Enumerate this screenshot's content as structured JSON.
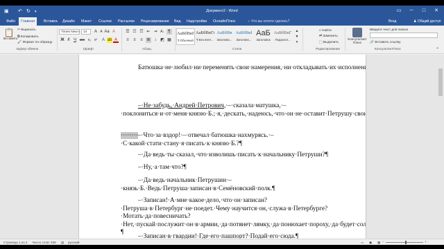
{
  "window": {
    "title": "Документ2 - Word",
    "qa_save_icon": "save-icon",
    "qa_undo_icon": "undo-icon",
    "qa_redo_icon": "redo-icon",
    "min_glyph": "─",
    "max_glyph": "□",
    "close_glyph": "✕",
    "ribbon_opt_glyph": "▭"
  },
  "tabs": [
    "Файл",
    "Главная",
    "Вставка",
    "Дизайн",
    "Макет",
    "Ссылки",
    "Рассылки",
    "Рецензирование",
    "Вид",
    "Надстройки",
    "ОнлайнПлюс"
  ],
  "active_tab": 1,
  "tell_me": "Что вы хотите сделать?",
  "account": {
    "signin": "Вход",
    "share": "Общий доступ"
  },
  "ribbon": {
    "clipboard": {
      "paste": "Вставить",
      "cut": "Вырезать",
      "copy": "Копировать",
      "format_painter": "Формат по образцу",
      "label": "Буфер обмена"
    },
    "font": {
      "name": "Times New Rom",
      "size": "14",
      "label": "Шрифт",
      "buttons": [
        "Ж",
        "К",
        "Ч",
        "abc",
        "x₂",
        "x²"
      ]
    },
    "paragraph": {
      "label": "Абзац",
      "pilcrow": "¶"
    },
    "styles": {
      "label": "Стили",
      "items": [
        {
          "preview": "АаБбВвГг,",
          "name": "¶ Обычный"
        },
        {
          "preview": "АаБбВвГг,",
          "name": "¶ Без инте..."
        },
        {
          "preview": "АаБбВв",
          "name": "Заголово..."
        },
        {
          "preview": "АаБбВвІ",
          "name": "Заголово..."
        },
        {
          "preview": "АаБ",
          "name": "Заголовок"
        },
        {
          "preview": "АаБбВвГ",
          "name": "Подзагол..."
        }
      ]
    },
    "editing": {
      "label": "Редактирование",
      "find": "Найти",
      "replace": "Заменить",
      "select": "Выделить"
    },
    "consultant": {
      "label": "КонсультантПлюс",
      "search_placeholder": "Введите текст для поиска",
      "button": "Консультант Плюс",
      "insert_link": "Вставить ссылку"
    }
  },
  "document": {
    "p1": "Батюшка·не·любил·ни·переменять·свои·намерения,·ни·откладывать·их·исполнение.·День·отъезду·моему·был·назначен.·Накануне·батюшка·объявил,·что·намерен·писать·со·мною·к·будущему·моему·начальнику,·и·потребовал·пера·и·бумаги.¶",
    "p2_a": "–·Не·забудь,·Андрей·Петрович",
    "p2_b": ",·–·сказала·матушка,·–·поклониться·и·от·меня·князю·Б.;·я,·дескать,·надеюсь,·что·он·не·оставит·Петрушу·своими·милостями.¶",
    "p3_hl": "········",
    "p3": "–·Что·за·вздор!·–·отвечал·батюшка·нахмурясь.·–·С·какой·стати·стану·я·писать·к·князю·Б.?¶",
    "p4": "–·Да·ведь·ты·сказал,·что·изволишь·писать·к·начальнику·Петруши?¶",
    "p5": "–·Ну,·а·там·что?¶",
    "p6": "–·Да·ведь·начальник·Петрушин·–·князь·Б.·Ведь·Петруша·записан·в·Семёновский·полк.¶",
    "p7": "–·Записан!·А·мне·какое·дело,·что·он·записан?·Петруша·в·Петербург·не·поедет.·Чему·научится·он,·служа·в·Петербурге?·Мотать·да·повесничать?·Нет,·пускай·послужит·он·в·армии,·да·потянет·лямку,·да·понюхает·пороху,·да·будет·солдат,·а·не·шаматон!¶",
    "p8": "–·Записан·в·гвардии!·Где·его·пашпорт?·Подай·его·сюда.¶"
  },
  "status": {
    "page": "Страница 1 из 2",
    "words": "Число слов: 539",
    "lang": "русский"
  },
  "colors": {
    "accent": "#2b579a"
  }
}
